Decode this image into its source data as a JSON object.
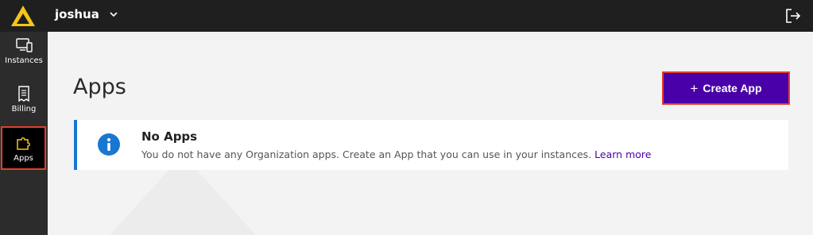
{
  "header": {
    "org_name": "joshua",
    "icons": {
      "logo": "logo-icon",
      "org_menu": "chevron-down-icon",
      "logout": "logout-icon"
    }
  },
  "sidebar": {
    "items": [
      {
        "label": "Instances",
        "icon": "instances-icon",
        "active": false
      },
      {
        "label": "Billing",
        "icon": "billing-icon",
        "active": false
      },
      {
        "label": "Apps",
        "icon": "puzzle-icon",
        "active": true
      }
    ]
  },
  "main": {
    "title": "Apps",
    "create_button": {
      "label": "Create App",
      "icon": "plus-icon"
    },
    "notice": {
      "icon": "info-icon",
      "title": "No Apps",
      "message": "You do not have any Organization apps. Create an App that you can use in your instances.",
      "link": "Learn more"
    }
  },
  "colors": {
    "accent": "#4a00a8",
    "logo": "#f5c518",
    "info": "#1976d2",
    "highlight": "#e53d2f"
  }
}
